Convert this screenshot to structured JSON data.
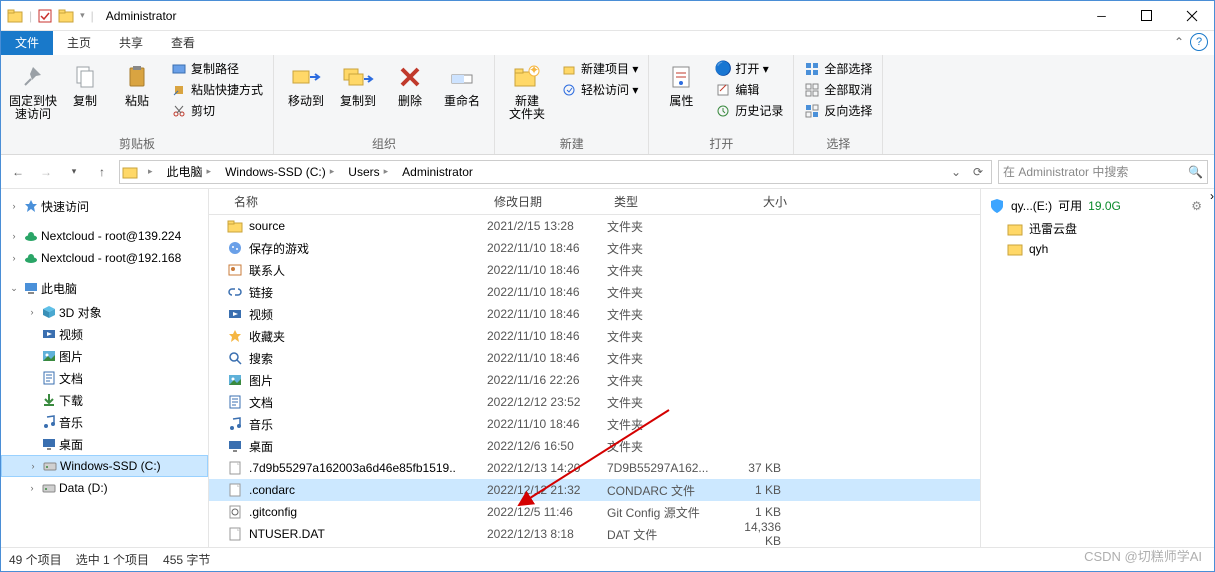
{
  "title": "Administrator",
  "tabs": {
    "file": "文件",
    "home": "主页",
    "share": "共享",
    "view": "查看"
  },
  "ribbon": {
    "clipboard": {
      "label": "剪贴板",
      "pin": "固定到快\n速访问",
      "copy": "复制",
      "paste": "粘贴",
      "copypath": "复制路径",
      "pasteshortcut": "粘贴快捷方式",
      "cut": "剪切"
    },
    "organize": {
      "label": "组织",
      "moveto": "移动到",
      "copyto": "复制到",
      "delete": "删除",
      "rename": "重命名"
    },
    "new": {
      "label": "新建",
      "newfolder": "新建\n文件夹",
      "newitem": "新建项目 ▾",
      "easyaccess": "轻松访问 ▾"
    },
    "open": {
      "label": "打开",
      "properties": "属性",
      "open": "打开 ▾",
      "edit": "编辑",
      "history": "历史记录"
    },
    "select": {
      "label": "选择",
      "all": "全部选择",
      "none": "全部取消",
      "invert": "反向选择"
    }
  },
  "breadcrumbs": [
    "此电脑",
    "Windows-SSD (C:)",
    "Users",
    "Administrator"
  ],
  "search_placeholder": "在 Administrator 中搜索",
  "columns": {
    "name": "名称",
    "date": "修改日期",
    "type": "类型",
    "size": "大小"
  },
  "tree": [
    {
      "chev": ">",
      "icon": "star",
      "label": "快速访问",
      "indent": 0
    },
    {
      "chev": ">",
      "icon": "cloud",
      "label": "Nextcloud - root@139.224",
      "indent": 0
    },
    {
      "chev": ">",
      "icon": "cloud",
      "label": "Nextcloud - root@192.168",
      "indent": 0
    },
    {
      "chev": "v",
      "icon": "pc",
      "label": "此电脑",
      "indent": 0
    },
    {
      "chev": ">",
      "icon": "3d",
      "label": "3D 对象",
      "indent": 1
    },
    {
      "chev": "",
      "icon": "video",
      "label": "视频",
      "indent": 1
    },
    {
      "chev": "",
      "icon": "pic",
      "label": "图片",
      "indent": 1
    },
    {
      "chev": "",
      "icon": "doc",
      "label": "文档",
      "indent": 1
    },
    {
      "chev": "",
      "icon": "dl",
      "label": "下载",
      "indent": 1
    },
    {
      "chev": "",
      "icon": "music",
      "label": "音乐",
      "indent": 1
    },
    {
      "chev": "",
      "icon": "desktop",
      "label": "桌面",
      "indent": 1
    },
    {
      "chev": ">",
      "icon": "drive",
      "label": "Windows-SSD (C:)",
      "indent": 1,
      "sel": true
    },
    {
      "chev": ">",
      "icon": "drive",
      "label": "Data (D:)",
      "indent": 1
    }
  ],
  "files": [
    {
      "icon": "folder",
      "name": "source",
      "date": "2021/2/15 13:28",
      "type": "文件夹",
      "size": ""
    },
    {
      "icon": "games",
      "name": "保存的游戏",
      "date": "2022/11/10 18:46",
      "type": "文件夹",
      "size": ""
    },
    {
      "icon": "contacts",
      "name": "联系人",
      "date": "2022/11/10 18:46",
      "type": "文件夹",
      "size": ""
    },
    {
      "icon": "links",
      "name": "链接",
      "date": "2022/11/10 18:46",
      "type": "文件夹",
      "size": ""
    },
    {
      "icon": "video",
      "name": "视频",
      "date": "2022/11/10 18:46",
      "type": "文件夹",
      "size": ""
    },
    {
      "icon": "fav",
      "name": "收藏夹",
      "date": "2022/11/10 18:46",
      "type": "文件夹",
      "size": ""
    },
    {
      "icon": "search",
      "name": "搜索",
      "date": "2022/11/10 18:46",
      "type": "文件夹",
      "size": ""
    },
    {
      "icon": "pic",
      "name": "图片",
      "date": "2022/11/16 22:26",
      "type": "文件夹",
      "size": ""
    },
    {
      "icon": "doc",
      "name": "文档",
      "date": "2022/12/12 23:52",
      "type": "文件夹",
      "size": ""
    },
    {
      "icon": "music",
      "name": "音乐",
      "date": "2022/11/10 18:46",
      "type": "文件夹",
      "size": ""
    },
    {
      "icon": "desktop",
      "name": "桌面",
      "date": "2022/12/6 16:50",
      "type": "文件夹",
      "size": ""
    },
    {
      "icon": "file",
      "name": ".7d9b55297a162003a6d46e85fb1519..",
      "date": "2022/12/13 14:20",
      "type": "7D9B55297A162...",
      "size": "37 KB"
    },
    {
      "icon": "file",
      "name": ".condarc",
      "date": "2022/12/12 21:32",
      "type": "CONDARC 文件",
      "size": "1 KB",
      "sel": true
    },
    {
      "icon": "cfg",
      "name": ".gitconfig",
      "date": "2022/12/5 11:46",
      "type": "Git Config 源文件",
      "size": "1 KB"
    },
    {
      "icon": "file",
      "name": "NTUSER.DAT",
      "date": "2022/12/13 8:18",
      "type": "DAT 文件",
      "size": "14,336 KB"
    }
  ],
  "sidepanel": {
    "drive": "qy...(E:)",
    "avail": "可用",
    "free": "19.0G",
    "items": [
      "迅雷云盘",
      "qyh"
    ]
  },
  "status": {
    "count": "49 个项目",
    "sel": "选中 1 个项目",
    "bytes": "455 字节"
  },
  "watermark": "CSDN @切糕师学AI"
}
